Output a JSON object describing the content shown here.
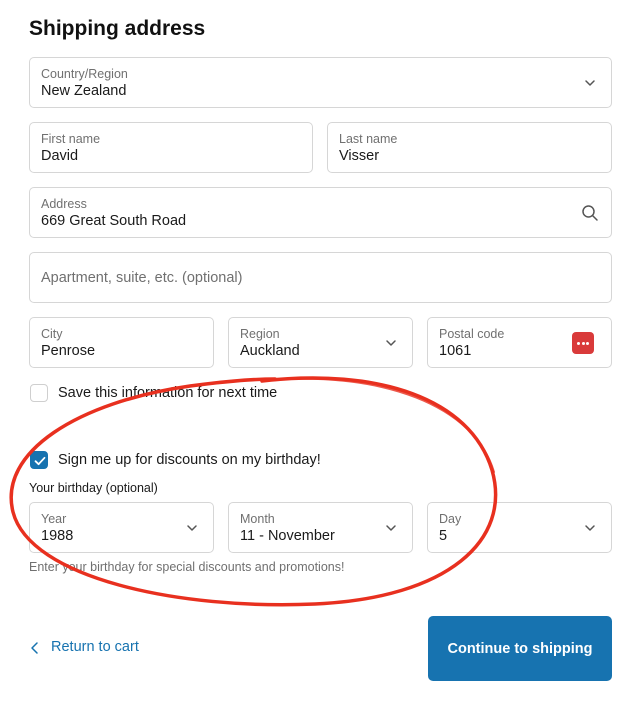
{
  "page": {
    "title": "Shipping address"
  },
  "country": {
    "label": "Country/Region",
    "value": "New Zealand"
  },
  "first_name": {
    "label": "First name",
    "value": "David"
  },
  "last_name": {
    "label": "Last name",
    "value": "Visser"
  },
  "address": {
    "label": "Address",
    "value": "669 Great South Road"
  },
  "apartment": {
    "placeholder": "Apartment, suite, etc. (optional)"
  },
  "city": {
    "label": "City",
    "value": "Penrose"
  },
  "region": {
    "label": "Region",
    "value": "Auckland"
  },
  "postal": {
    "label": "Postal code",
    "value": "1061"
  },
  "save_info": {
    "label": "Save this information for next time",
    "checked": false
  },
  "birthday_signup": {
    "label": "Sign me up for discounts on my birthday!",
    "checked": true
  },
  "birthday": {
    "heading": "Your birthday (optional)",
    "year": {
      "label": "Year",
      "value": "1988"
    },
    "month": {
      "label": "Month",
      "value": "11 - November"
    },
    "day": {
      "label": "Day",
      "value": "5"
    },
    "hint": "Enter your birthday for special discounts and promotions!"
  },
  "nav": {
    "back_label": "Return to cart",
    "continue_label": "Continue to shipping"
  },
  "colors": {
    "accent": "#1773b0",
    "annotation": "#e8301f",
    "password_manager": "#d93a3a"
  },
  "icons": [
    "chevron-down-icon",
    "search-icon",
    "password-manager-icon",
    "checkmark-icon",
    "chevron-left-icon"
  ]
}
